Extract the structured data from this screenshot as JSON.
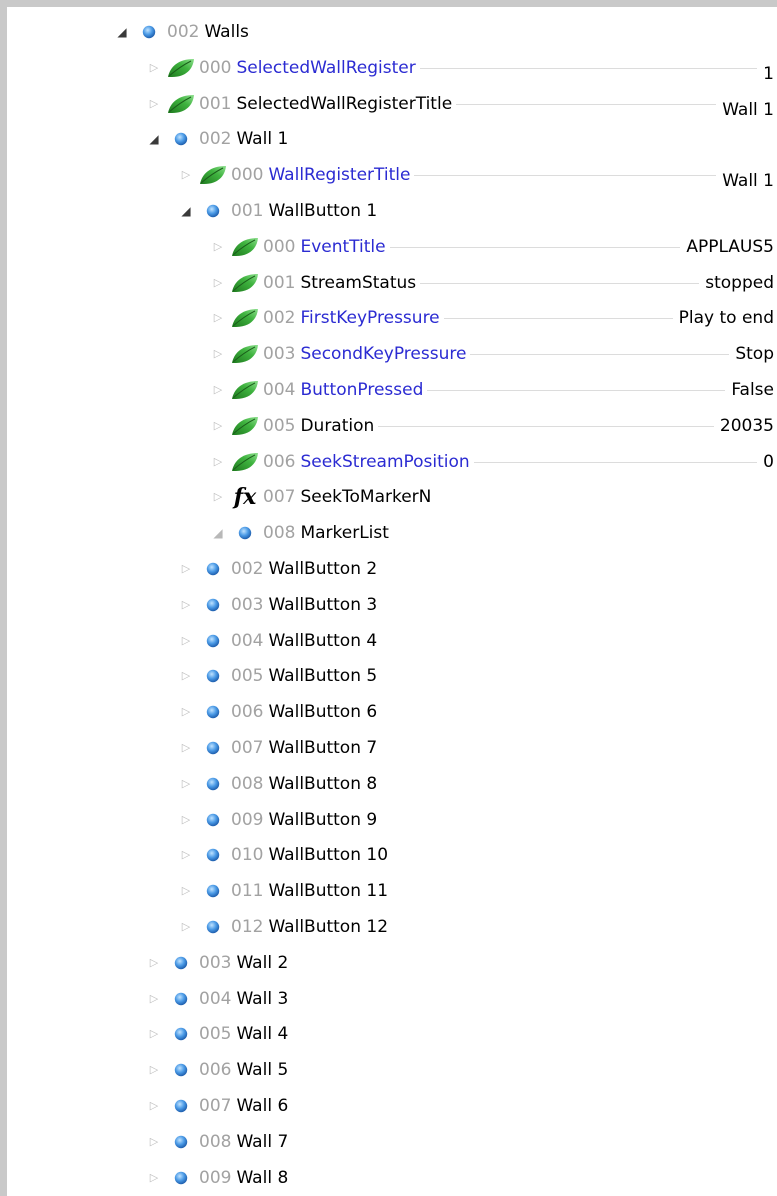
{
  "tree": [
    {
      "id": "r0",
      "depth": 0,
      "state": "expanded",
      "icon": "blue-sphere-icon",
      "num": "002",
      "name": "Walls",
      "blue": false,
      "value": ""
    },
    {
      "id": "r1",
      "depth": 1,
      "state": "collapsed",
      "icon": "green-leaf-icon",
      "num": "000",
      "name": "SelectedWallRegister",
      "blue": true,
      "value": "1"
    },
    {
      "id": "r2",
      "depth": 1,
      "state": "collapsed",
      "icon": "green-leaf-icon",
      "num": "001",
      "name": "SelectedWallRegisterTitle",
      "blue": false,
      "value": "Wall 1"
    },
    {
      "id": "r3",
      "depth": 1,
      "state": "expanded",
      "icon": "blue-sphere-icon",
      "num": "002",
      "name": "Wall 1",
      "blue": false,
      "value": ""
    },
    {
      "id": "r4",
      "depth": 2,
      "state": "collapsed",
      "icon": "green-leaf-icon",
      "num": "000",
      "name": "WallRegisterTitle",
      "blue": true,
      "value": "Wall 1"
    },
    {
      "id": "r5",
      "depth": 2,
      "state": "expanded",
      "icon": "blue-sphere-icon",
      "num": "001",
      "name": "WallButton 1",
      "blue": false,
      "value": ""
    },
    {
      "id": "r6",
      "depth": 3,
      "state": "collapsed",
      "icon": "green-leaf-icon",
      "num": "000",
      "name": "EventTitle",
      "blue": true,
      "value": "APPLAUS5"
    },
    {
      "id": "r7",
      "depth": 3,
      "state": "collapsed",
      "icon": "green-leaf-icon",
      "num": "001",
      "name": "StreamStatus",
      "blue": false,
      "value": "stopped"
    },
    {
      "id": "r8",
      "depth": 3,
      "state": "collapsed",
      "icon": "green-leaf-icon",
      "num": "002",
      "name": "FirstKeyPressure",
      "blue": true,
      "value": "Play to end"
    },
    {
      "id": "r9",
      "depth": 3,
      "state": "collapsed",
      "icon": "green-leaf-icon",
      "num": "003",
      "name": "SecondKeyPressure",
      "blue": true,
      "value": "Stop"
    },
    {
      "id": "r10",
      "depth": 3,
      "state": "collapsed",
      "icon": "green-leaf-icon",
      "num": "004",
      "name": "ButtonPressed",
      "blue": true,
      "value": "False"
    },
    {
      "id": "r11",
      "depth": 3,
      "state": "collapsed",
      "icon": "green-leaf-icon",
      "num": "005",
      "name": "Duration",
      "blue": false,
      "value": "20035"
    },
    {
      "id": "r12",
      "depth": 3,
      "state": "collapsed",
      "icon": "green-leaf-icon",
      "num": "006",
      "name": "SeekStreamPosition",
      "blue": true,
      "value": "0"
    },
    {
      "id": "r13",
      "depth": 3,
      "state": "collapsed",
      "icon": "fx-function-icon",
      "num": "007",
      "name": "SeekToMarkerN",
      "blue": false,
      "value": ""
    },
    {
      "id": "r14",
      "depth": 3,
      "state": "expanded-empty",
      "icon": "blue-sphere-icon",
      "num": "008",
      "name": "MarkerList",
      "blue": false,
      "value": ""
    },
    {
      "id": "r15",
      "depth": 2,
      "state": "collapsed",
      "icon": "blue-sphere-icon",
      "num": "002",
      "name": "WallButton 2",
      "blue": false,
      "value": ""
    },
    {
      "id": "r16",
      "depth": 2,
      "state": "collapsed",
      "icon": "blue-sphere-icon",
      "num": "003",
      "name": "WallButton 3",
      "blue": false,
      "value": ""
    },
    {
      "id": "r17",
      "depth": 2,
      "state": "collapsed",
      "icon": "blue-sphere-icon",
      "num": "004",
      "name": "WallButton 4",
      "blue": false,
      "value": ""
    },
    {
      "id": "r18",
      "depth": 2,
      "state": "collapsed",
      "icon": "blue-sphere-icon",
      "num": "005",
      "name": "WallButton 5",
      "blue": false,
      "value": ""
    },
    {
      "id": "r19",
      "depth": 2,
      "state": "collapsed",
      "icon": "blue-sphere-icon",
      "num": "006",
      "name": "WallButton 6",
      "blue": false,
      "value": ""
    },
    {
      "id": "r20",
      "depth": 2,
      "state": "collapsed",
      "icon": "blue-sphere-icon",
      "num": "007",
      "name": "WallButton 7",
      "blue": false,
      "value": ""
    },
    {
      "id": "r21",
      "depth": 2,
      "state": "collapsed",
      "icon": "blue-sphere-icon",
      "num": "008",
      "name": "WallButton 8",
      "blue": false,
      "value": ""
    },
    {
      "id": "r22",
      "depth": 2,
      "state": "collapsed",
      "icon": "blue-sphere-icon",
      "num": "009",
      "name": "WallButton 9",
      "blue": false,
      "value": ""
    },
    {
      "id": "r23",
      "depth": 2,
      "state": "collapsed",
      "icon": "blue-sphere-icon",
      "num": "010",
      "name": "WallButton 10",
      "blue": false,
      "value": ""
    },
    {
      "id": "r24",
      "depth": 2,
      "state": "collapsed",
      "icon": "blue-sphere-icon",
      "num": "011",
      "name": "WallButton 11",
      "blue": false,
      "value": ""
    },
    {
      "id": "r25",
      "depth": 2,
      "state": "collapsed",
      "icon": "blue-sphere-icon",
      "num": "012",
      "name": "WallButton 12",
      "blue": false,
      "value": ""
    },
    {
      "id": "r26",
      "depth": 1,
      "state": "collapsed",
      "icon": "blue-sphere-icon",
      "num": "003",
      "name": "Wall 2",
      "blue": false,
      "value": ""
    },
    {
      "id": "r27",
      "depth": 1,
      "state": "collapsed",
      "icon": "blue-sphere-icon",
      "num": "004",
      "name": "Wall 3",
      "blue": false,
      "value": ""
    },
    {
      "id": "r28",
      "depth": 1,
      "state": "collapsed",
      "icon": "blue-sphere-icon",
      "num": "005",
      "name": "Wall 4",
      "blue": false,
      "value": ""
    },
    {
      "id": "r29",
      "depth": 1,
      "state": "collapsed",
      "icon": "blue-sphere-icon",
      "num": "006",
      "name": "Wall 5",
      "blue": false,
      "value": ""
    },
    {
      "id": "r30",
      "depth": 1,
      "state": "collapsed",
      "icon": "blue-sphere-icon",
      "num": "007",
      "name": "Wall 6",
      "blue": false,
      "value": ""
    },
    {
      "id": "r31",
      "depth": 1,
      "state": "collapsed",
      "icon": "blue-sphere-icon",
      "num": "008",
      "name": "Wall 7",
      "blue": false,
      "value": ""
    },
    {
      "id": "r32",
      "depth": 1,
      "state": "collapsed",
      "icon": "blue-sphere-icon",
      "num": "009",
      "name": "Wall 8",
      "blue": false,
      "value": ""
    }
  ],
  "colors": {
    "blue_text": "#2b2bd2",
    "number_gray": "#a2a2a2",
    "sphere_blue": "#3d8fe0",
    "leaf_green": "#3cb43c",
    "leader_line": "#dcdcdc",
    "frame_border": "#c9c9c9"
  }
}
